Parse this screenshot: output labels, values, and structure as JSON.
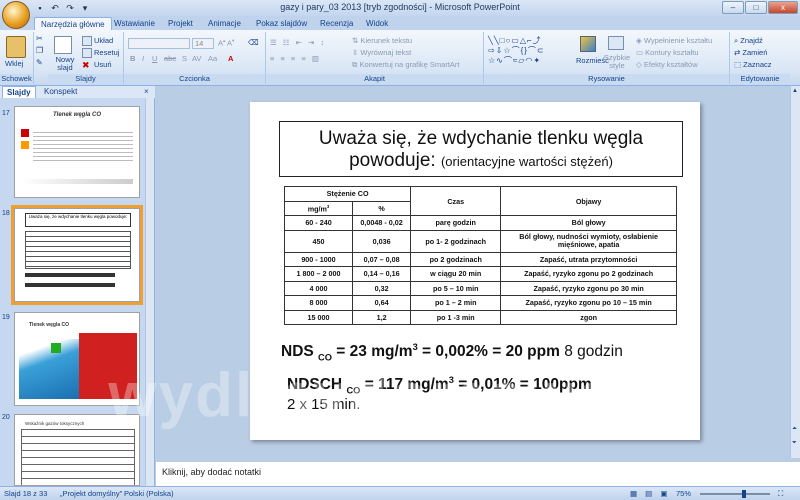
{
  "window": {
    "title": "gazy i pary_03 2013 [tryb zgodności] - Microsoft PowerPoint",
    "controls": [
      "–",
      "□",
      "x"
    ]
  },
  "tabs": [
    "Narzędzia główne",
    "Wstawianie",
    "Projekt",
    "Animacje",
    "Pokaz slajdów",
    "Recenzja",
    "Widok"
  ],
  "ribbon": {
    "schowek": {
      "label": "Schowek",
      "paste": "Wklej"
    },
    "slajdy": {
      "label": "Slajdy",
      "new_slide": "Nowy slajd",
      "layout": "Układ",
      "reset": "Resetuj",
      "delete": "Usuń"
    },
    "czcionka": {
      "label": "Czcionka",
      "font_size": "14"
    },
    "akapit": {
      "label": "Akapit",
      "text_direction": "Kierunek tekstu",
      "align_text": "Wyrównaj tekst",
      "smartart": "Konwertuj na grafikę SmartArt"
    },
    "rysowanie": {
      "label": "Rysowanie",
      "arrange": "Rozmieść",
      "quick_styles": "Szybkie style",
      "fill": "Wypełnienie kształtu",
      "outline": "Kontury kształtu",
      "effects": "Efekty kształtów"
    },
    "edytowanie": {
      "label": "Edytowanie",
      "find": "Znajdź",
      "replace": "Zamień",
      "select": "Zaznacz"
    }
  },
  "pane_tabs": [
    "Slajdy",
    "Konspekt"
  ],
  "thumbnails": [
    {
      "num": "17",
      "title": "Tlenek węgla CO"
    },
    {
      "num": "18",
      "title": "Uważa się, że wdychanie tlenku węgla powoduje:"
    },
    {
      "num": "19",
      "title": "Tlenek węgla CO"
    },
    {
      "num": "20",
      "title": "Wskaźnik gazów toksycznych"
    }
  ],
  "slide": {
    "title_line1": "Uważa się, że wdychanie tlenku węgla",
    "title_line2": "powoduje:",
    "title_line2_small": "(orientacyjne wartości stężeń)",
    "table": {
      "headers": {
        "stezenie": "Stężenie CO",
        "mgm3": "mg/m",
        "mgm3_sup": "3",
        "pct": "%",
        "czas": "Czas",
        "objawy": "Objawy"
      },
      "rows": [
        [
          "60 - 240",
          "0,0048 - 0,02",
          "parę godzin",
          "Ból głowy"
        ],
        [
          "450",
          "0,036",
          "po 1- 2 godzinach",
          "Ból głowy, nudności wymioty, osłabienie mięśniowe, apatia"
        ],
        [
          "900 - 1000",
          "0,07 – 0,08",
          "po 2 godzinach",
          "Zapaść, utrata przytomności"
        ],
        [
          "1 800 – 2 000",
          "0,14 – 0,16",
          "w ciągu 20 min",
          "Zapaść, ryzyko zgonu po 2 godzinach"
        ],
        [
          "4 000",
          "0,32",
          "po 5 – 10 min",
          "Zapaść, ryzyko zgonu po 30 min"
        ],
        [
          "8 000",
          "0,64",
          "po 1 – 2 min",
          "Zapaść, ryzyko zgonu po 10 – 15 min"
        ],
        [
          "15 000",
          "1,2",
          "po 1 -3 min",
          "zgon"
        ]
      ]
    },
    "nds": {
      "a": "NDS",
      "sub": "CO",
      "b": " = 23 mg/m",
      "sup": "3",
      "c": " = 0,002% = 20 ppm",
      "d": " 8 godzin"
    },
    "ndsch": {
      "a": "NDSCH",
      "sub": "CO",
      "b": " = 117 mg/m",
      "sup": "3",
      "c": " = 0,01% = 100ppm",
      "line2": "2 x 15 min."
    }
  },
  "notes_placeholder": "Kliknij, aby dodać notatki",
  "status": {
    "slide_info": "Slajd 18 z 33",
    "theme": "„Projekt domyślny\"",
    "language": "Polski (Polska)",
    "zoom": "75%"
  },
  "watermark": "wydlinydomowe.pl"
}
